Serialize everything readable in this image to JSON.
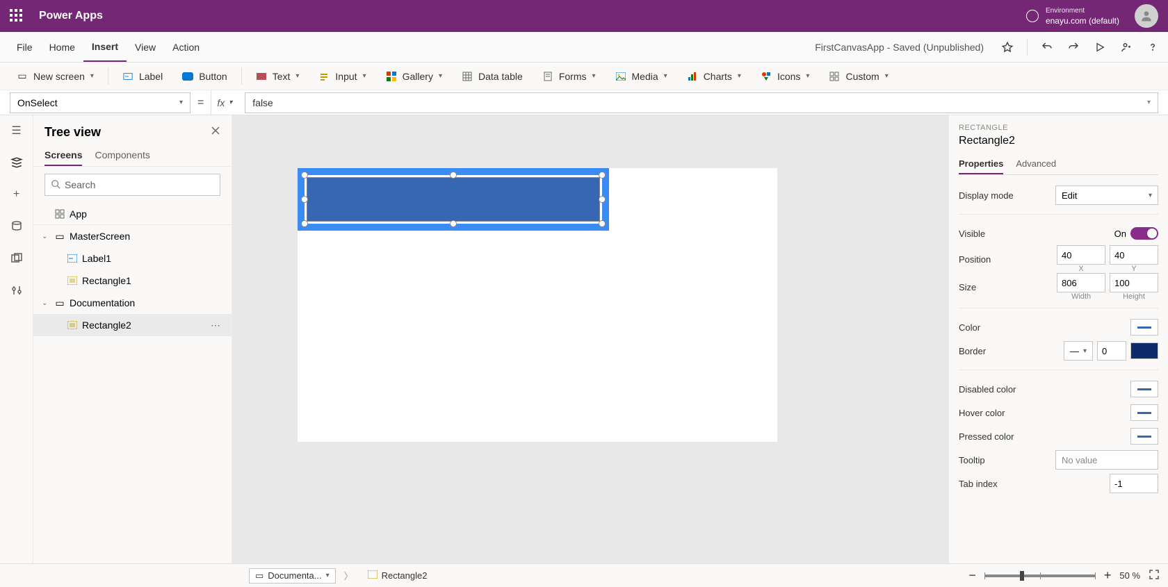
{
  "titlebar": {
    "appname": "Power Apps",
    "env_label": "Environment",
    "env_value": "enayu.com (default)"
  },
  "menubar": {
    "items": [
      "File",
      "Home",
      "Insert",
      "View",
      "Action"
    ],
    "active": "Insert",
    "docname": "FirstCanvasApp - Saved (Unpublished)"
  },
  "ribbon": {
    "newscreen": "New screen",
    "label": "Label",
    "button": "Button",
    "text": "Text",
    "input": "Input",
    "gallery": "Gallery",
    "datatable": "Data table",
    "forms": "Forms",
    "media": "Media",
    "charts": "Charts",
    "icons": "Icons",
    "custom": "Custom"
  },
  "formula": {
    "property": "OnSelect",
    "value": "false"
  },
  "tree": {
    "title": "Tree view",
    "tabs": {
      "screens": "Screens",
      "components": "Components"
    },
    "search_placeholder": "Search",
    "app": "App",
    "items": [
      {
        "name": "MasterScreen",
        "children": [
          {
            "name": "Label1",
            "type": "label"
          },
          {
            "name": "Rectangle1",
            "type": "rect"
          }
        ]
      },
      {
        "name": "Documentation",
        "children": [
          {
            "name": "Rectangle2",
            "type": "rect",
            "selected": true
          }
        ]
      }
    ]
  },
  "properties": {
    "crumb": "RECTANGLE",
    "objname": "Rectangle2",
    "tabs": {
      "properties": "Properties",
      "advanced": "Advanced"
    },
    "display_mode_label": "Display mode",
    "display_mode_value": "Edit",
    "visible_label": "Visible",
    "visible_value": "On",
    "position_label": "Position",
    "position_x": "40",
    "position_y": "40",
    "x_label": "X",
    "y_label": "Y",
    "size_label": "Size",
    "size_w": "806",
    "size_h": "100",
    "w_label": "Width",
    "h_label": "Height",
    "color_label": "Color",
    "border_label": "Border",
    "border_width": "0",
    "disabled_color_label": "Disabled color",
    "hover_color_label": "Hover color",
    "pressed_color_label": "Pressed color",
    "tooltip_label": "Tooltip",
    "tooltip_placeholder": "No value",
    "tabindex_label": "Tab index",
    "tabindex_value": "-1"
  },
  "statusbar": {
    "screen": "Documenta...",
    "selection": "Rectangle2",
    "zoom": "50",
    "zoom_suffix": "%"
  }
}
